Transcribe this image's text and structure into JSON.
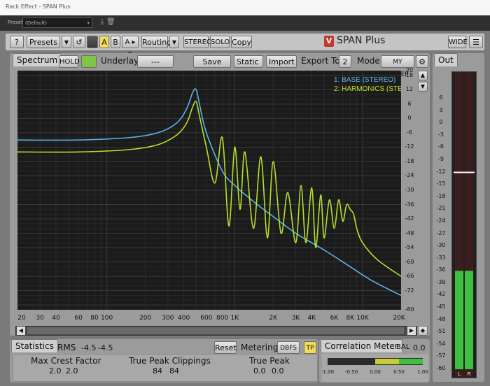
{
  "host": {
    "window_title": "Rack Effect - SPAN Plus",
    "presets_label": "Presets:",
    "preset_value": "(Default)"
  },
  "toolbar": {
    "help": "?",
    "presets": "Presets",
    "a": "A",
    "b": "B",
    "ab": "A ▸ B",
    "routing": "Routing",
    "stereo": "STEREO",
    "solo": "SOLO",
    "copy": "Copy",
    "logo": "SPAN Plus",
    "wide": "WIDE"
  },
  "spectrum": {
    "tab": "Spectrum",
    "hold": "HOLD",
    "underlay_label": "Underlay",
    "underlay_value": "---",
    "save_png": "Save PNG",
    "static": "Static",
    "import": "Import",
    "export_label": "Export To",
    "export_value": "2",
    "mode_label": "Mode",
    "mode_value": "MY SWEEP",
    "legend": [
      "1: BASE (STEREO)",
      "2: HARMONICS (STEREO)"
    ],
    "colors": {
      "base": "#58b4e6",
      "harmonics": "#b6e02a"
    },
    "y_ticks": [
      "20",
      "18",
      "12",
      "6",
      "0",
      "-6",
      "-12",
      "-18",
      "-24",
      "-30",
      "-36",
      "-42",
      "-48",
      "-54",
      "-60",
      "-66",
      "-72",
      "-80"
    ],
    "x_ticks": [
      "20",
      "30",
      "40",
      "60",
      "80",
      "100",
      "200",
      "300",
      "400",
      "600",
      "800",
      "1K",
      "2K",
      "3K",
      "4K",
      "6K",
      "8K",
      "10K",
      "20K"
    ]
  },
  "chart_data": {
    "type": "line",
    "xlabel": "",
    "ylabel": "",
    "x_scale": "log",
    "xlim": [
      20,
      20000
    ],
    "ylim": [
      -80,
      20
    ],
    "grid": true,
    "legend_position": "top-right",
    "series": [
      {
        "name": "1: BASE (STEREO)",
        "x": [
          20,
          60,
          150,
          250,
          350,
          420,
          470,
          500,
          530,
          600,
          800,
          1000,
          1500,
          2000,
          3000,
          5000,
          8000,
          12000,
          20000
        ],
        "y": [
          -9,
          -9,
          -8,
          -6,
          -2,
          4,
          11,
          12,
          6,
          -6,
          -22,
          -28,
          -36,
          -41,
          -48,
          -55,
          -62,
          -68,
          -74
        ]
      },
      {
        "name": "2: HARMONICS (STEREO)",
        "x": [
          20,
          60,
          150,
          250,
          350,
          420,
          470,
          500,
          530,
          600,
          700,
          800,
          900,
          1000,
          1100,
          1200,
          1400,
          1600,
          1800,
          2000,
          2300,
          2600,
          3000,
          3300,
          3600,
          4000,
          4300,
          4700,
          5000,
          5500,
          6000,
          6500,
          7000,
          7500,
          8000,
          8500,
          9000,
          10000,
          13000,
          20000
        ],
        "y": [
          -14,
          -14,
          -13,
          -11,
          -7,
          -2,
          5,
          7,
          1,
          -12,
          -27,
          -8,
          -45,
          -12,
          -38,
          -14,
          -46,
          -16,
          -50,
          -18,
          -48,
          -31,
          -52,
          -28,
          -52,
          -29,
          -54,
          -32,
          -50,
          -34,
          -46,
          -34,
          -43,
          -36,
          -38,
          -40,
          -46,
          -52,
          -59,
          -66
        ]
      }
    ]
  },
  "out": {
    "tab": "Out",
    "ticks": [
      "6",
      "3",
      "0",
      "-3",
      "-6",
      "-9",
      "-12",
      "-15",
      "-18",
      "-21",
      "-24",
      "-27",
      "-30",
      "-33",
      "-36",
      "-39",
      "-42",
      "-45",
      "-48",
      "-51",
      "-54",
      "-57",
      "-60"
    ],
    "channels": [
      "L",
      "R"
    ],
    "peak_db": -12,
    "level_db": -36
  },
  "stats": {
    "tab": "Statistics",
    "rms_label": "RMS",
    "rms_l": "-4.5",
    "rms_r": "-4.5",
    "reset": "Reset",
    "metering_label": "Metering",
    "metering_value": "DBFS",
    "tp": "TP",
    "crest_label": "Max Crest Factor",
    "crest_l": "2.0",
    "crest_r": "2.0",
    "clip_label": "True Peak Clippings",
    "clip_l": "84",
    "clip_r": "84",
    "tpeak_label": "True Peak",
    "tpeak_l": "0.0",
    "tpeak_r": "0.0"
  },
  "correlation": {
    "tab": "Correlation Meter",
    "bal_label": "BAL",
    "bal_value": "0.0",
    "ticks": [
      "-1.00",
      "-0.50",
      "0.00",
      "0.50",
      "1.00"
    ],
    "value": 1.0
  }
}
